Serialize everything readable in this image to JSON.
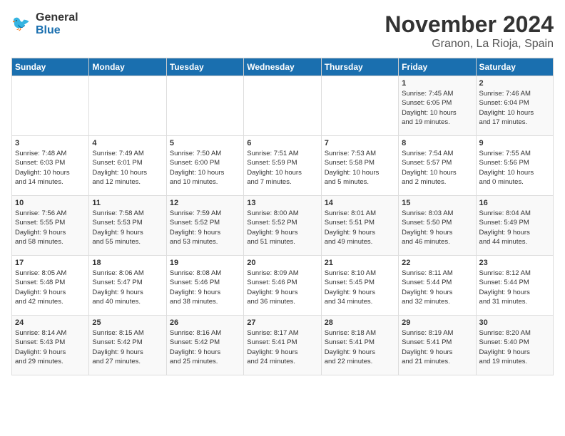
{
  "logo": {
    "line1": "General",
    "line2": "Blue"
  },
  "title": "November 2024",
  "location": "Granon, La Rioja, Spain",
  "weekdays": [
    "Sunday",
    "Monday",
    "Tuesday",
    "Wednesday",
    "Thursday",
    "Friday",
    "Saturday"
  ],
  "weeks": [
    [
      {
        "day": "",
        "info": ""
      },
      {
        "day": "",
        "info": ""
      },
      {
        "day": "",
        "info": ""
      },
      {
        "day": "",
        "info": ""
      },
      {
        "day": "",
        "info": ""
      },
      {
        "day": "1",
        "info": "Sunrise: 7:45 AM\nSunset: 6:05 PM\nDaylight: 10 hours\nand 19 minutes."
      },
      {
        "day": "2",
        "info": "Sunrise: 7:46 AM\nSunset: 6:04 PM\nDaylight: 10 hours\nand 17 minutes."
      }
    ],
    [
      {
        "day": "3",
        "info": "Sunrise: 7:48 AM\nSunset: 6:03 PM\nDaylight: 10 hours\nand 14 minutes."
      },
      {
        "day": "4",
        "info": "Sunrise: 7:49 AM\nSunset: 6:01 PM\nDaylight: 10 hours\nand 12 minutes."
      },
      {
        "day": "5",
        "info": "Sunrise: 7:50 AM\nSunset: 6:00 PM\nDaylight: 10 hours\nand 10 minutes."
      },
      {
        "day": "6",
        "info": "Sunrise: 7:51 AM\nSunset: 5:59 PM\nDaylight: 10 hours\nand 7 minutes."
      },
      {
        "day": "7",
        "info": "Sunrise: 7:53 AM\nSunset: 5:58 PM\nDaylight: 10 hours\nand 5 minutes."
      },
      {
        "day": "8",
        "info": "Sunrise: 7:54 AM\nSunset: 5:57 PM\nDaylight: 10 hours\nand 2 minutes."
      },
      {
        "day": "9",
        "info": "Sunrise: 7:55 AM\nSunset: 5:56 PM\nDaylight: 10 hours\nand 0 minutes."
      }
    ],
    [
      {
        "day": "10",
        "info": "Sunrise: 7:56 AM\nSunset: 5:55 PM\nDaylight: 9 hours\nand 58 minutes."
      },
      {
        "day": "11",
        "info": "Sunrise: 7:58 AM\nSunset: 5:53 PM\nDaylight: 9 hours\nand 55 minutes."
      },
      {
        "day": "12",
        "info": "Sunrise: 7:59 AM\nSunset: 5:52 PM\nDaylight: 9 hours\nand 53 minutes."
      },
      {
        "day": "13",
        "info": "Sunrise: 8:00 AM\nSunset: 5:52 PM\nDaylight: 9 hours\nand 51 minutes."
      },
      {
        "day": "14",
        "info": "Sunrise: 8:01 AM\nSunset: 5:51 PM\nDaylight: 9 hours\nand 49 minutes."
      },
      {
        "day": "15",
        "info": "Sunrise: 8:03 AM\nSunset: 5:50 PM\nDaylight: 9 hours\nand 46 minutes."
      },
      {
        "day": "16",
        "info": "Sunrise: 8:04 AM\nSunset: 5:49 PM\nDaylight: 9 hours\nand 44 minutes."
      }
    ],
    [
      {
        "day": "17",
        "info": "Sunrise: 8:05 AM\nSunset: 5:48 PM\nDaylight: 9 hours\nand 42 minutes."
      },
      {
        "day": "18",
        "info": "Sunrise: 8:06 AM\nSunset: 5:47 PM\nDaylight: 9 hours\nand 40 minutes."
      },
      {
        "day": "19",
        "info": "Sunrise: 8:08 AM\nSunset: 5:46 PM\nDaylight: 9 hours\nand 38 minutes."
      },
      {
        "day": "20",
        "info": "Sunrise: 8:09 AM\nSunset: 5:46 PM\nDaylight: 9 hours\nand 36 minutes."
      },
      {
        "day": "21",
        "info": "Sunrise: 8:10 AM\nSunset: 5:45 PM\nDaylight: 9 hours\nand 34 minutes."
      },
      {
        "day": "22",
        "info": "Sunrise: 8:11 AM\nSunset: 5:44 PM\nDaylight: 9 hours\nand 32 minutes."
      },
      {
        "day": "23",
        "info": "Sunrise: 8:12 AM\nSunset: 5:44 PM\nDaylight: 9 hours\nand 31 minutes."
      }
    ],
    [
      {
        "day": "24",
        "info": "Sunrise: 8:14 AM\nSunset: 5:43 PM\nDaylight: 9 hours\nand 29 minutes."
      },
      {
        "day": "25",
        "info": "Sunrise: 8:15 AM\nSunset: 5:42 PM\nDaylight: 9 hours\nand 27 minutes."
      },
      {
        "day": "26",
        "info": "Sunrise: 8:16 AM\nSunset: 5:42 PM\nDaylight: 9 hours\nand 25 minutes."
      },
      {
        "day": "27",
        "info": "Sunrise: 8:17 AM\nSunset: 5:41 PM\nDaylight: 9 hours\nand 24 minutes."
      },
      {
        "day": "28",
        "info": "Sunrise: 8:18 AM\nSunset: 5:41 PM\nDaylight: 9 hours\nand 22 minutes."
      },
      {
        "day": "29",
        "info": "Sunrise: 8:19 AM\nSunset: 5:41 PM\nDaylight: 9 hours\nand 21 minutes."
      },
      {
        "day": "30",
        "info": "Sunrise: 8:20 AM\nSunset: 5:40 PM\nDaylight: 9 hours\nand 19 minutes."
      }
    ]
  ]
}
